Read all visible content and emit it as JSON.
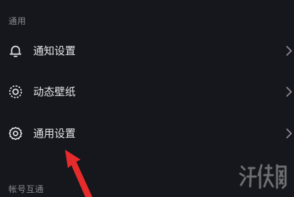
{
  "sections": {
    "general": {
      "header": "通用",
      "items": [
        {
          "icon": "bell-icon",
          "label": "通知设置"
        },
        {
          "icon": "wallpaper-icon",
          "label": "动态壁纸"
        },
        {
          "icon": "gear-icon",
          "label": "通用设置"
        }
      ]
    },
    "account": {
      "header": "帐号互通"
    }
  },
  "colors": {
    "background": "#16171c",
    "text": "#e6e6ea",
    "section_header": "#8a8b90",
    "arrow": "#e52b2b"
  },
  "watermark": {
    "text": "游侠网"
  }
}
